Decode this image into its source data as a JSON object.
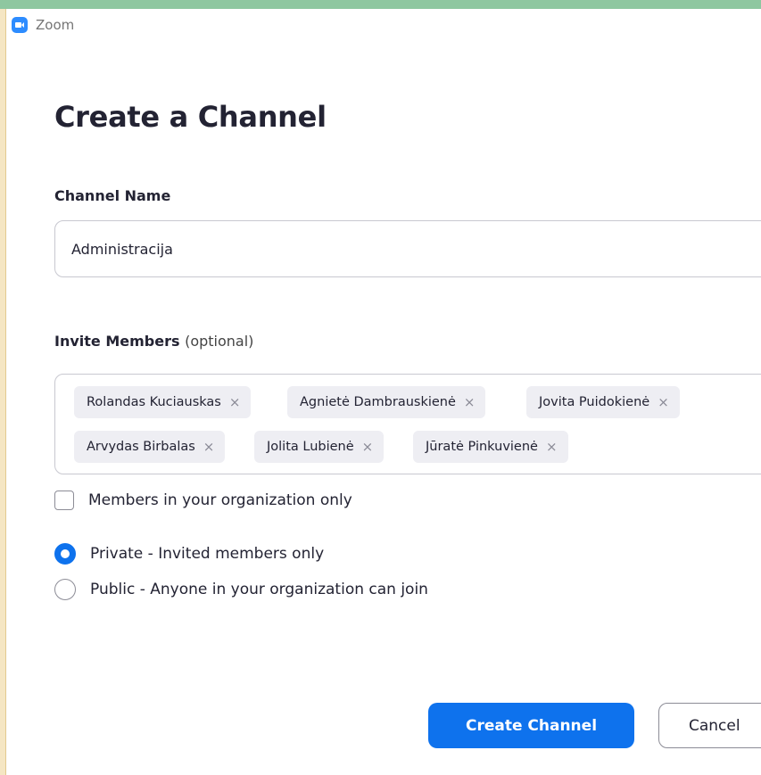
{
  "window": {
    "title": "Zoom",
    "icon": "zoom-camera-icon"
  },
  "form": {
    "heading": "Create a Channel",
    "channel_name_label": "Channel Name",
    "channel_name_value": "Administracija",
    "invite_label": "Invite Members",
    "invite_optional": "(optional)",
    "members": [
      "Rolandas Kuciauskas",
      "Agnietė Dambrauskienė",
      "Jovita Puidokienė",
      "Arvydas Birbalas",
      "Jolita Lubienė",
      "Jūratė Pinkuvienė"
    ],
    "remove_glyph": "×",
    "org_only_label": "Members in your organization only",
    "org_only_checked": false,
    "visibility": {
      "private_label": "Private - Invited members only",
      "public_label": "Public - Anyone in your organization can join",
      "selected": "private"
    },
    "create_button": "Create Channel",
    "cancel_button": "Cancel"
  },
  "colors": {
    "accent": "#0e72ed",
    "top_bar": "#8ec7a0",
    "side_bar": "#f5e6c3"
  }
}
